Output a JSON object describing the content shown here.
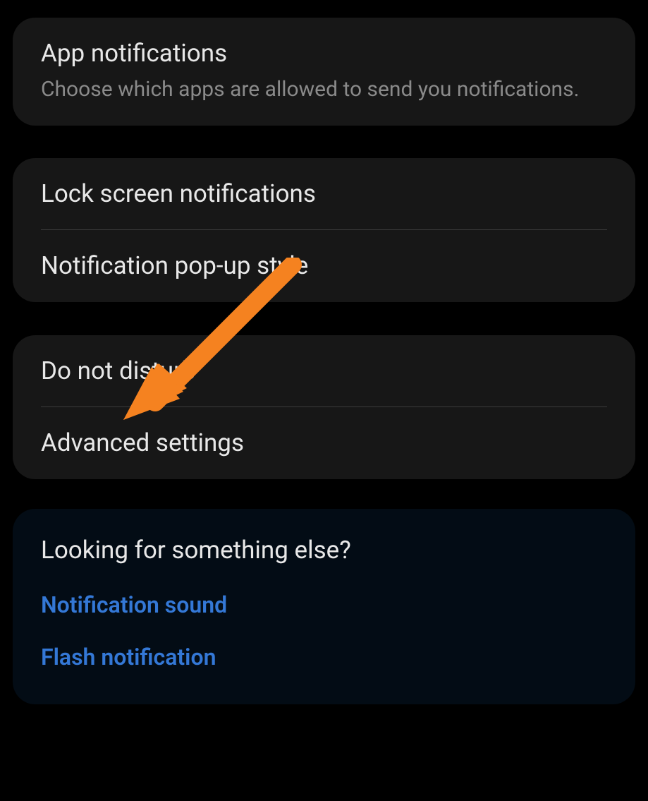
{
  "cards": {
    "card1": {
      "app_notifications": {
        "title": "App notifications",
        "subtitle": "Choose which apps are allowed to send you notifications."
      }
    },
    "card2": {
      "lock_screen": "Lock screen notifications",
      "popup_style": "Notification pop-up style"
    },
    "card3": {
      "dnd": "Do not disturb",
      "advanced": "Advanced settings"
    },
    "card4": {
      "heading": "Looking for something else?",
      "link1": "Notification sound",
      "link2": "Flash notification"
    }
  },
  "annotation": {
    "arrow_color": "#f58220"
  }
}
